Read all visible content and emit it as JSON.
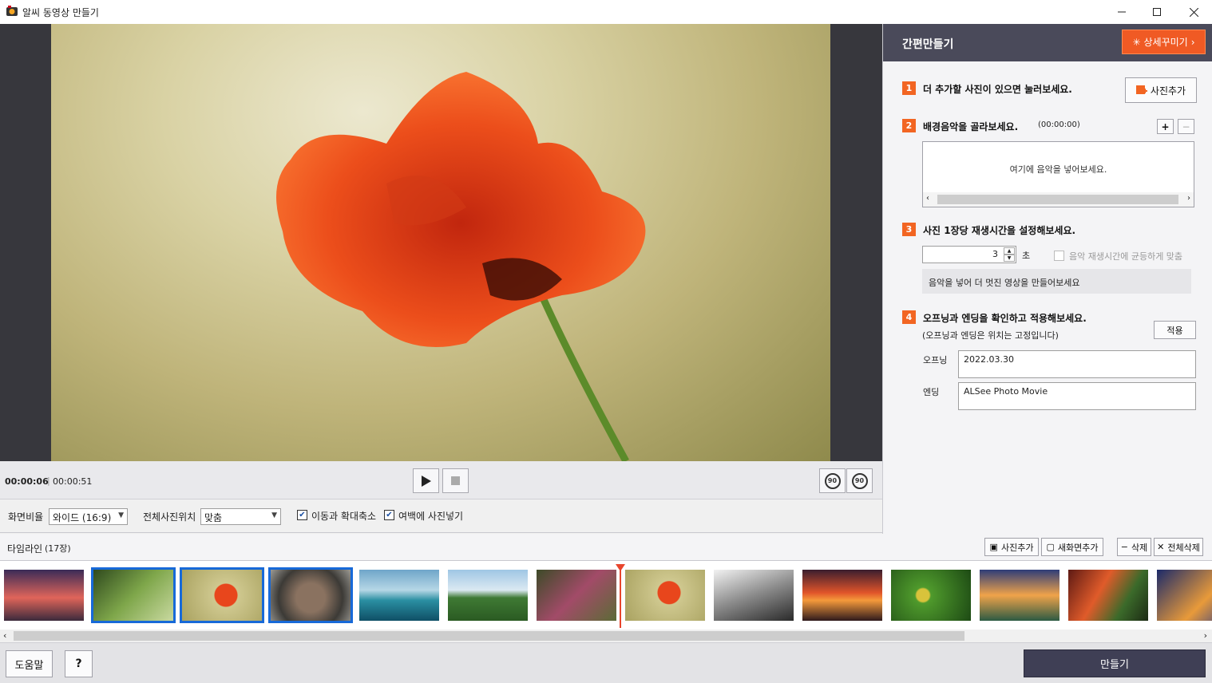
{
  "window": {
    "title": "알씨 동영상 만들기",
    "minimize_icon": "minimize-icon",
    "maximize_icon": "maximize-icon",
    "close_icon": "close-icon"
  },
  "player": {
    "current_time": "00:00:06",
    "separator": "|",
    "total_time": "00:00:51",
    "play_icon": "play-icon",
    "stop_icon": "stop-icon",
    "rotate_left_label": "90",
    "rotate_right_label": "90"
  },
  "options": {
    "aspect_label": "화면비율",
    "aspect_value": "와이드 (16:9)",
    "position_label": "전체사진위치",
    "position_value": "맞춤",
    "zoom_label": "이동과 확대축소",
    "zoom_checked": "✔",
    "margin_label": "여백에 사진넣기",
    "margin_checked": "✔"
  },
  "panel": {
    "title": "간편만들기",
    "detail_button": "상세꾸미기",
    "step1": {
      "num": "1",
      "text": "더 추가할 사진이 있으면 눌러보세요.",
      "button": "사진추가"
    },
    "step2": {
      "num": "2",
      "text": "배경음악을 골라보세요.",
      "duration": "(00:00:00)",
      "add": "+",
      "remove": "−",
      "hint": "여기에 음악을 넣어보세요."
    },
    "step3": {
      "num": "3",
      "text": "사진 1장당 재생시간을 설정해보세요.",
      "value": "3",
      "unit": "초",
      "sync_label": "음악 재생시간에 균등하게 맞춤",
      "banner": "음악을 넣어 더 멋진 영상을 만들어보세요"
    },
    "step4": {
      "num": "4",
      "text": "오프닝과 엔딩을 확인하고 적용해보세요.",
      "subtext": "(오프닝과 엔딩은 위치는 고정입니다)",
      "apply": "적용",
      "opening_label": "오프닝",
      "opening_value": "2022.03.30",
      "ending_label": "엔딩",
      "ending_value": "ALSee Photo Movie"
    }
  },
  "timeline": {
    "title": "타임라인",
    "count": "(17장)",
    "add_photo": "사진추가",
    "add_screen": "새화면추가",
    "delete": "삭제",
    "delete_all": "전체삭제"
  },
  "footer": {
    "help": "도움말",
    "question": "?",
    "make": "만들기"
  },
  "colors": {
    "accent": "#f26522",
    "panel_header": "#4a4a5a",
    "selection": "#1769d8",
    "make_button": "#3f3f55"
  }
}
